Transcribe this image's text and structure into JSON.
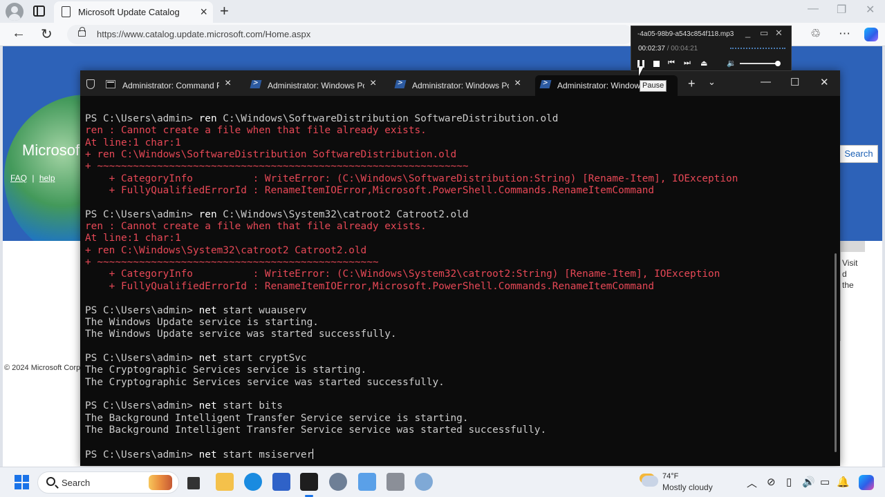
{
  "browser": {
    "tab_title": "Microsoft Update Catalog",
    "url": "https://www.catalog.update.microsoft.com/Home.aspx"
  },
  "webpage": {
    "logo_text": "Microsof",
    "faq": "FAQ",
    "separator": "|",
    "help": "help",
    "search_button": "Search",
    "copyright": "© 2024 Microsoft Corp",
    "side_text": [
      "Visit",
      "d",
      "the"
    ]
  },
  "terminal": {
    "tabs": [
      {
        "label": "Administrator: Command P",
        "icon": "cmd-icon"
      },
      {
        "label": "Administrator: Windows Po",
        "icon": "powershell-icon"
      },
      {
        "label": "Administrator: Windows Po",
        "icon": "powershell-icon"
      },
      {
        "label": "Administrator: Window",
        "icon": "powershell-icon",
        "active": true
      }
    ],
    "tooltip": "Pause",
    "lines": [
      {
        "type": "cmd",
        "prompt": "PS C:\\Users\\admin> ",
        "cmd": "ren",
        "args": " C:\\Windows\\SoftwareDistribution SoftwareDistribution.old"
      },
      {
        "type": "err",
        "text": "ren : Cannot create a file when that file already exists."
      },
      {
        "type": "err",
        "text": "At line:1 char:1"
      },
      {
        "type": "err",
        "text": "+ ren C:\\Windows\\SoftwareDistribution SoftwareDistribution.old"
      },
      {
        "type": "err",
        "text": "+ ~~~~~~~~~~~~~~~~~~~~~~~~~~~~~~~~~~~~~~~~~~~~~~~~~~~~~~~~~~~~~~"
      },
      {
        "type": "err",
        "text": "    + CategoryInfo          : WriteError: (C:\\Windows\\SoftwareDistribution:String) [Rename-Item], IOException"
      },
      {
        "type": "err",
        "text": "    + FullyQualifiedErrorId : RenameItemIOError,Microsoft.PowerShell.Commands.RenameItemCommand"
      },
      {
        "type": "blank",
        "text": ""
      },
      {
        "type": "cmd",
        "prompt": "PS C:\\Users\\admin> ",
        "cmd": "ren",
        "args": " C:\\Windows\\System32\\catroot2 Catroot2.old"
      },
      {
        "type": "err",
        "text": "ren : Cannot create a file when that file already exists."
      },
      {
        "type": "err",
        "text": "At line:1 char:1"
      },
      {
        "type": "err",
        "text": "+ ren C:\\Windows\\System32\\catroot2 Catroot2.old"
      },
      {
        "type": "err",
        "text": "+ ~~~~~~~~~~~~~~~~~~~~~~~~~~~~~~~~~~~~~~~~~~~~~~~"
      },
      {
        "type": "err",
        "text": "    + CategoryInfo          : WriteError: (C:\\Windows\\System32\\catroot2:String) [Rename-Item], IOException"
      },
      {
        "type": "err",
        "text": "    + FullyQualifiedErrorId : RenameItemIOError,Microsoft.PowerShell.Commands.RenameItemCommand"
      },
      {
        "type": "blank",
        "text": ""
      },
      {
        "type": "cmd",
        "prompt": "PS C:\\Users\\admin> ",
        "cmd": "net",
        "args": " start wuauserv"
      },
      {
        "type": "out",
        "text": "The Windows Update service is starting."
      },
      {
        "type": "out",
        "text": "The Windows Update service was started successfully."
      },
      {
        "type": "blank",
        "text": ""
      },
      {
        "type": "cmd",
        "prompt": "PS C:\\Users\\admin> ",
        "cmd": "net",
        "args": " start cryptSvc"
      },
      {
        "type": "out",
        "text": "The Cryptographic Services service is starting."
      },
      {
        "type": "out",
        "text": "The Cryptographic Services service was started successfully."
      },
      {
        "type": "blank",
        "text": ""
      },
      {
        "type": "cmd",
        "prompt": "PS C:\\Users\\admin> ",
        "cmd": "net",
        "args": " start bits"
      },
      {
        "type": "out",
        "text": "The Background Intelligent Transfer Service service is starting."
      },
      {
        "type": "out",
        "text": "The Background Intelligent Transfer Service service was started successfully."
      },
      {
        "type": "blank",
        "text": ""
      },
      {
        "type": "cmd",
        "prompt": "PS C:\\Users\\admin> ",
        "cmd": "net",
        "args": " start msiserver",
        "caret": true
      }
    ]
  },
  "player": {
    "file_name": "-4a05-98b9-a543c854f118.mp3",
    "elapsed": "00:02:37",
    "separator": "/",
    "duration": "00:04:21",
    "volume_level": 0.95
  },
  "taskbar": {
    "search_placeholder": "Search",
    "weather_temp": "74°F",
    "weather_desc": "Mostly cloudy"
  },
  "colors": {
    "error": "#e74856",
    "terminal_bg": "#0c0c0c",
    "page_blue": "#2d62b8",
    "accent": "#1a73e8"
  }
}
